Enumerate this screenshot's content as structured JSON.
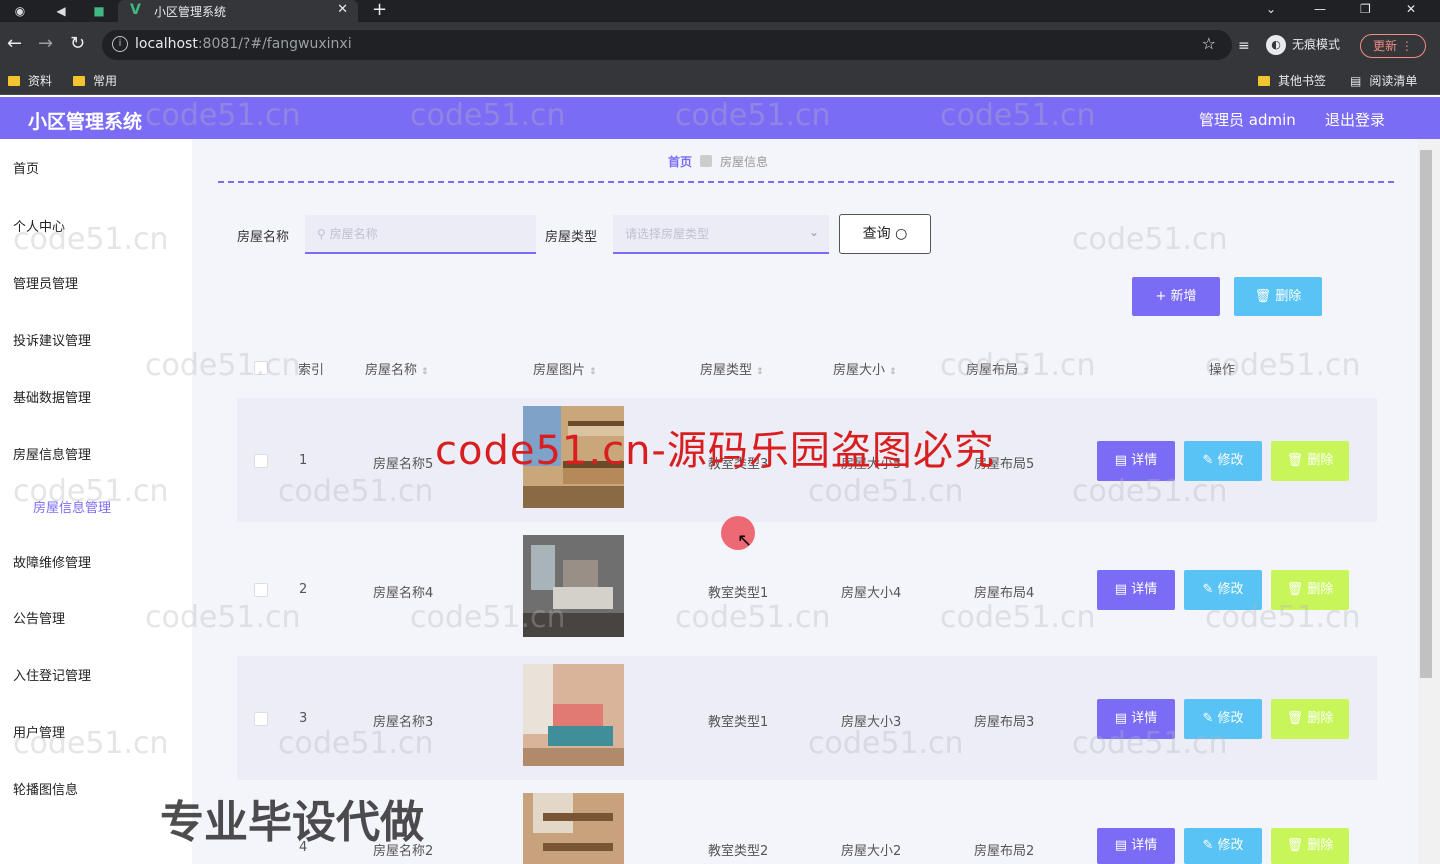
{
  "browser": {
    "tab_title": "小区管理系统",
    "tab_close": "✕",
    "new_tab": "+",
    "url_host": "localhost",
    "url_rest": ":8081/?#/fangwuxinxi",
    "incognito_label": "无痕模式",
    "update_label": "更新",
    "bookmarks": [
      "资料",
      "常用"
    ],
    "bookmarks_right": [
      "其他书签",
      "阅读清单"
    ]
  },
  "app": {
    "title": "小区管理系统",
    "user": "管理员 admin",
    "logout": "退出登录"
  },
  "sidebar": {
    "items": [
      "首页",
      "个人中心",
      "管理员管理",
      "投诉建议管理",
      "基础数据管理",
      "房屋信息管理",
      "故障维修管理",
      "公告管理",
      "入住登记管理",
      "用户管理",
      "轮播图信息"
    ],
    "active_sub": "房屋信息管理"
  },
  "breadcrumb": {
    "home": "首页",
    "current": "房屋信息"
  },
  "search": {
    "name_label": "房屋名称",
    "name_placeholder": "房屋名称",
    "type_label": "房屋类型",
    "type_placeholder": "请选择房屋类型",
    "query_label": "查询"
  },
  "toolbar": {
    "add_label": "+ 新增",
    "delete_label": "删除"
  },
  "table": {
    "headers": [
      "索引",
      "房屋名称",
      "房屋图片",
      "房屋类型",
      "房屋大小",
      "房屋布局",
      "操作"
    ],
    "rows": [
      {
        "index": "1",
        "name": "房屋名称5",
        "type": "教室类型3",
        "size": "房屋大小5",
        "layout": "房屋布局5"
      },
      {
        "index": "2",
        "name": "房屋名称4",
        "type": "教室类型1",
        "size": "房屋大小4",
        "layout": "房屋布局4"
      },
      {
        "index": "3",
        "name": "房屋名称3",
        "type": "教室类型1",
        "size": "房屋大小3",
        "layout": "房屋布局3"
      },
      {
        "index": "4",
        "name": "房屋名称2",
        "type": "教室类型2",
        "size": "房屋大小2",
        "layout": "房屋布局2"
      }
    ],
    "actions": {
      "detail": "详情",
      "edit": "修改",
      "delete": "删除"
    }
  },
  "overlays": {
    "watermark_text": "code51.cn-源码乐园盗图必究",
    "promo_text": "专业毕设代做",
    "tile_text": "code51.cn"
  },
  "colors": {
    "primary": "#7b6cf6",
    "info": "#59c3f5",
    "warning": "#c8f55a"
  }
}
